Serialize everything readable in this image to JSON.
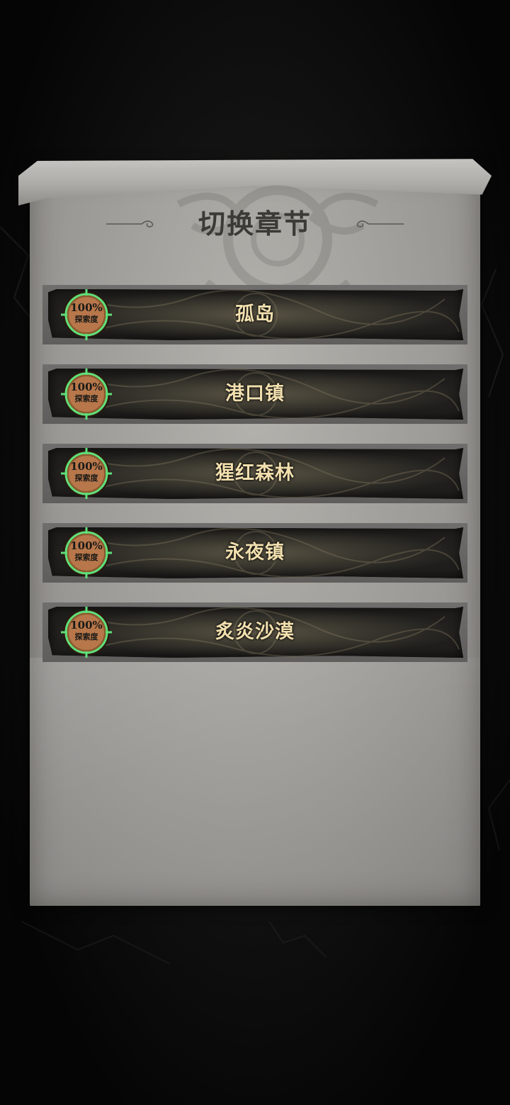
{
  "dialog": {
    "title": "切换章节"
  },
  "chapters": [
    {
      "name": "孤岛",
      "progress_value": "100%",
      "progress_label": "探索度",
      "progress_fraction": 1.0
    },
    {
      "name": "港口镇",
      "progress_value": "100%",
      "progress_label": "探索度",
      "progress_fraction": 1.0
    },
    {
      "name": "猩红森林",
      "progress_value": "100%",
      "progress_label": "探索度",
      "progress_fraction": 1.0
    },
    {
      "name": "永夜镇",
      "progress_value": "100%",
      "progress_label": "探索度",
      "progress_fraction": 1.0
    },
    {
      "name": "炙炎沙漠",
      "progress_value": "100%",
      "progress_label": "探索度",
      "progress_fraction": 1.0
    }
  ],
  "colors": {
    "progress_ring": "#5fe07a",
    "chapter_text": "#f1dfae",
    "title_text": "#3b3a37"
  },
  "icons": {
    "title_left_ornament": "flourish-left-icon",
    "title_right_ornament": "flourish-right-icon",
    "progress_badge": "compass-ring-icon"
  }
}
